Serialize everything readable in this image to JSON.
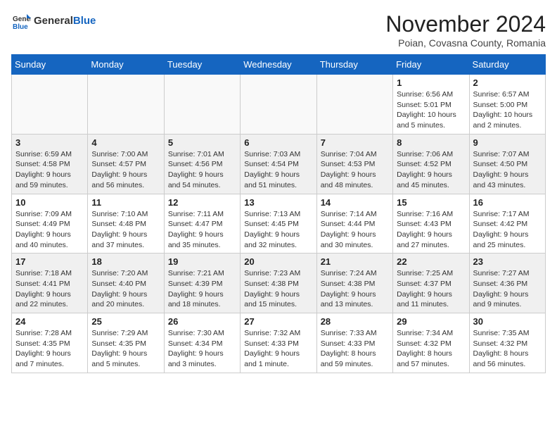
{
  "header": {
    "logo_general": "General",
    "logo_blue": "Blue",
    "month_title": "November 2024",
    "location": "Poian, Covasna County, Romania"
  },
  "weekdays": [
    "Sunday",
    "Monday",
    "Tuesday",
    "Wednesday",
    "Thursday",
    "Friday",
    "Saturday"
  ],
  "weeks": [
    [
      {
        "day": "",
        "info": ""
      },
      {
        "day": "",
        "info": ""
      },
      {
        "day": "",
        "info": ""
      },
      {
        "day": "",
        "info": ""
      },
      {
        "day": "",
        "info": ""
      },
      {
        "day": "1",
        "info": "Sunrise: 6:56 AM\nSunset: 5:01 PM\nDaylight: 10 hours and 5 minutes."
      },
      {
        "day": "2",
        "info": "Sunrise: 6:57 AM\nSunset: 5:00 PM\nDaylight: 10 hours and 2 minutes."
      }
    ],
    [
      {
        "day": "3",
        "info": "Sunrise: 6:59 AM\nSunset: 4:58 PM\nDaylight: 9 hours and 59 minutes."
      },
      {
        "day": "4",
        "info": "Sunrise: 7:00 AM\nSunset: 4:57 PM\nDaylight: 9 hours and 56 minutes."
      },
      {
        "day": "5",
        "info": "Sunrise: 7:01 AM\nSunset: 4:56 PM\nDaylight: 9 hours and 54 minutes."
      },
      {
        "day": "6",
        "info": "Sunrise: 7:03 AM\nSunset: 4:54 PM\nDaylight: 9 hours and 51 minutes."
      },
      {
        "day": "7",
        "info": "Sunrise: 7:04 AM\nSunset: 4:53 PM\nDaylight: 9 hours and 48 minutes."
      },
      {
        "day": "8",
        "info": "Sunrise: 7:06 AM\nSunset: 4:52 PM\nDaylight: 9 hours and 45 minutes."
      },
      {
        "day": "9",
        "info": "Sunrise: 7:07 AM\nSunset: 4:50 PM\nDaylight: 9 hours and 43 minutes."
      }
    ],
    [
      {
        "day": "10",
        "info": "Sunrise: 7:09 AM\nSunset: 4:49 PM\nDaylight: 9 hours and 40 minutes."
      },
      {
        "day": "11",
        "info": "Sunrise: 7:10 AM\nSunset: 4:48 PM\nDaylight: 9 hours and 37 minutes."
      },
      {
        "day": "12",
        "info": "Sunrise: 7:11 AM\nSunset: 4:47 PM\nDaylight: 9 hours and 35 minutes."
      },
      {
        "day": "13",
        "info": "Sunrise: 7:13 AM\nSunset: 4:45 PM\nDaylight: 9 hours and 32 minutes."
      },
      {
        "day": "14",
        "info": "Sunrise: 7:14 AM\nSunset: 4:44 PM\nDaylight: 9 hours and 30 minutes."
      },
      {
        "day": "15",
        "info": "Sunrise: 7:16 AM\nSunset: 4:43 PM\nDaylight: 9 hours and 27 minutes."
      },
      {
        "day": "16",
        "info": "Sunrise: 7:17 AM\nSunset: 4:42 PM\nDaylight: 9 hours and 25 minutes."
      }
    ],
    [
      {
        "day": "17",
        "info": "Sunrise: 7:18 AM\nSunset: 4:41 PM\nDaylight: 9 hours and 22 minutes."
      },
      {
        "day": "18",
        "info": "Sunrise: 7:20 AM\nSunset: 4:40 PM\nDaylight: 9 hours and 20 minutes."
      },
      {
        "day": "19",
        "info": "Sunrise: 7:21 AM\nSunset: 4:39 PM\nDaylight: 9 hours and 18 minutes."
      },
      {
        "day": "20",
        "info": "Sunrise: 7:23 AM\nSunset: 4:38 PM\nDaylight: 9 hours and 15 minutes."
      },
      {
        "day": "21",
        "info": "Sunrise: 7:24 AM\nSunset: 4:38 PM\nDaylight: 9 hours and 13 minutes."
      },
      {
        "day": "22",
        "info": "Sunrise: 7:25 AM\nSunset: 4:37 PM\nDaylight: 9 hours and 11 minutes."
      },
      {
        "day": "23",
        "info": "Sunrise: 7:27 AM\nSunset: 4:36 PM\nDaylight: 9 hours and 9 minutes."
      }
    ],
    [
      {
        "day": "24",
        "info": "Sunrise: 7:28 AM\nSunset: 4:35 PM\nDaylight: 9 hours and 7 minutes."
      },
      {
        "day": "25",
        "info": "Sunrise: 7:29 AM\nSunset: 4:35 PM\nDaylight: 9 hours and 5 minutes."
      },
      {
        "day": "26",
        "info": "Sunrise: 7:30 AM\nSunset: 4:34 PM\nDaylight: 9 hours and 3 minutes."
      },
      {
        "day": "27",
        "info": "Sunrise: 7:32 AM\nSunset: 4:33 PM\nDaylight: 9 hours and 1 minute."
      },
      {
        "day": "28",
        "info": "Sunrise: 7:33 AM\nSunset: 4:33 PM\nDaylight: 8 hours and 59 minutes."
      },
      {
        "day": "29",
        "info": "Sunrise: 7:34 AM\nSunset: 4:32 PM\nDaylight: 8 hours and 57 minutes."
      },
      {
        "day": "30",
        "info": "Sunrise: 7:35 AM\nSunset: 4:32 PM\nDaylight: 8 hours and 56 minutes."
      }
    ]
  ]
}
